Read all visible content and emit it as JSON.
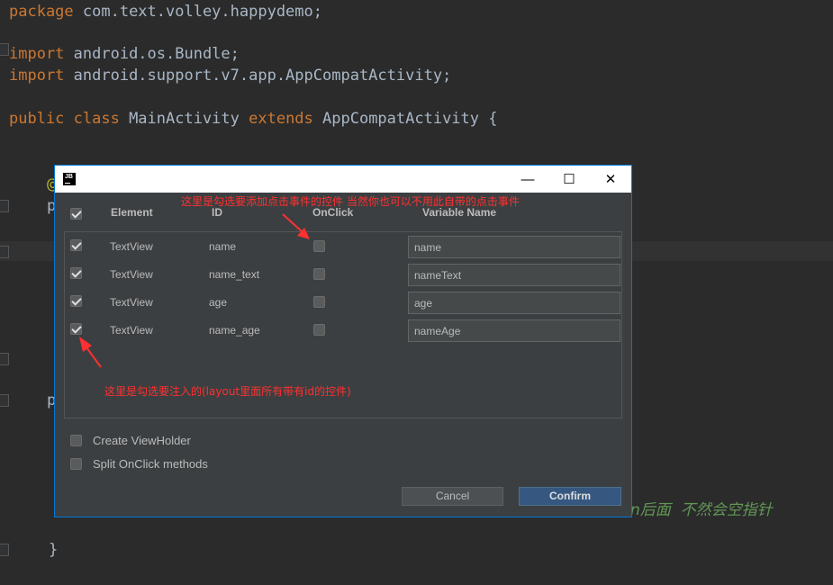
{
  "code": {
    "line1": {
      "kw": "package",
      "text": " com.text.volley.happydemo;"
    },
    "line2": {
      "kw": "import",
      "text": " android.os.Bundle;"
    },
    "line3": {
      "kw": "import",
      "text": " android.support.v7.app.AppCompatActivity;"
    },
    "line4": {
      "kw1": "public class",
      "mid": " MainActivity ",
      "kw2": "extends",
      "text": " AppCompatActivity {"
    },
    "frag_at": "@",
    "frag_p1": "p",
    "frag_p2": "p",
    "closing_brace": "}",
    "comment_fragment": "n后面  不然会空指针"
  },
  "dialog": {
    "logo": "JB",
    "minimize_symbol": "—",
    "maximize_symbol": "☐",
    "close_symbol": "✕",
    "headers": {
      "element": "Element",
      "id": "ID",
      "onclick": "OnClick",
      "variable": "Variable Name"
    },
    "rows": [
      {
        "checked": true,
        "element": "TextView",
        "id": "name",
        "onclick": false,
        "variable": "name"
      },
      {
        "checked": true,
        "element": "TextView",
        "id": "name_text",
        "onclick": false,
        "variable": "nameText"
      },
      {
        "checked": true,
        "element": "TextView",
        "id": "age",
        "onclick": false,
        "variable": "age"
      },
      {
        "checked": true,
        "element": "TextView",
        "id": "name_age",
        "onclick": false,
        "variable": "nameAge"
      }
    ],
    "options": {
      "create_viewholder": "Create ViewHolder",
      "split_onclick": "Split OnClick methods"
    },
    "buttons": {
      "cancel": "Cancel",
      "confirm": "Confirm"
    }
  },
  "annotations": {
    "top": "这里是勾选要添加点击事件的控件 当然你也可以不用此自带的点击事件",
    "bottom": "这里是勾选要注入的(layout里面所有带有id的控件)"
  },
  "colors": {
    "annotation": "#ff3030",
    "keyword": "#cc7832",
    "code_text": "#a9b7c6",
    "comment": "#629755",
    "dialog_border": "#0078d7"
  }
}
